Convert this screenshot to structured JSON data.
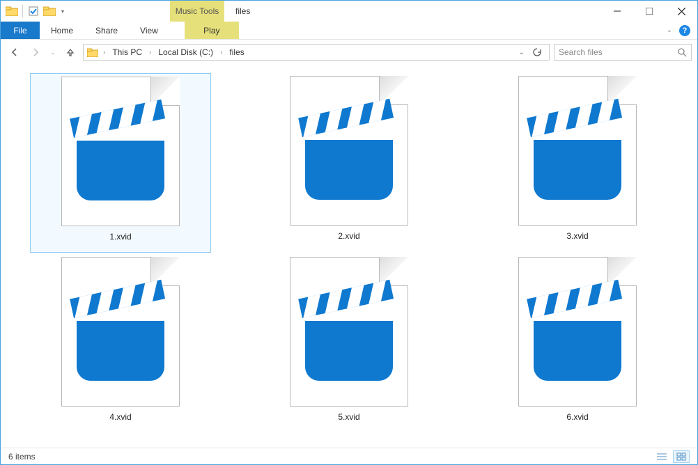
{
  "window": {
    "title": "files",
    "context_tab": "Music Tools"
  },
  "ribbon": {
    "file": "File",
    "home": "Home",
    "share": "Share",
    "view": "View",
    "play": "Play"
  },
  "breadcrumb": {
    "seg1": "This PC",
    "seg2": "Local Disk (C:)",
    "seg3": "files"
  },
  "search": {
    "placeholder": "Search files"
  },
  "files": {
    "f1": "1.xvid",
    "f2": "2.xvid",
    "f3": "3.xvid",
    "f4": "4.xvid",
    "f5": "5.xvid",
    "f6": "6.xvid"
  },
  "status": {
    "count": "6 items"
  }
}
